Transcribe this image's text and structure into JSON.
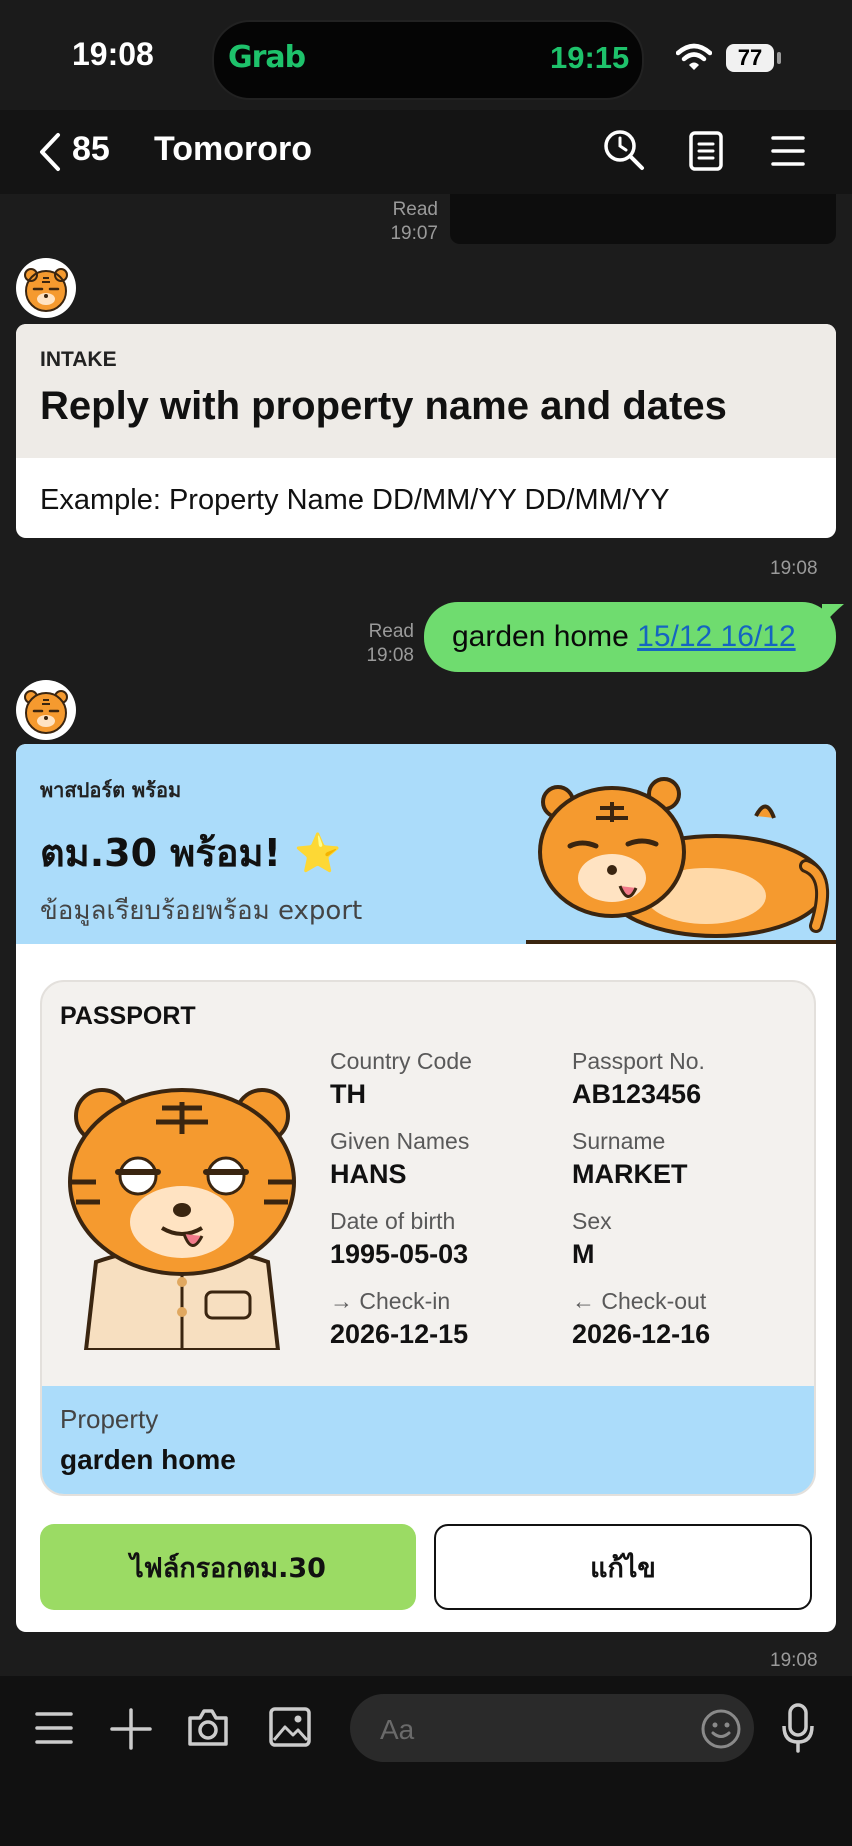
{
  "status_bar": {
    "time": "19:08",
    "island_app": "Grab",
    "island_time": "19:15",
    "battery": "77"
  },
  "nav": {
    "back_count": "85",
    "title": "Tomororo"
  },
  "messages": {
    "img_read": "Read",
    "img_time": "19:07",
    "intake": {
      "label": "INTAKE",
      "title": "Reply with property name and dates",
      "example": "Example: Property Name DD/MM/YY DD/MM/YY",
      "time": "19:08"
    },
    "user_msg": {
      "read": "Read",
      "time": "19:08",
      "text": "garden home",
      "dates": "15/12 16/12"
    },
    "passport_card": {
      "banner_small": "พาสปอร์ต พร้อม",
      "banner_title": "ตม.30 พร้อม!",
      "banner_star": "⭐",
      "banner_sub": "ข้อมูลเรียบร้อยพร้อม export",
      "passport_label": "PASSPORT",
      "fields": {
        "country_code_label": "Country Code",
        "country_code": "TH",
        "passport_no_label": "Passport No.",
        "passport_no": "AB123456",
        "given_names_label": "Given Names",
        "given_names": "HANS",
        "surname_label": "Surname",
        "surname": "MARKET",
        "dob_label": "Date of birth",
        "dob": "1995-05-03",
        "sex_label": "Sex",
        "sex": "M",
        "checkin_label": "→ Check-in",
        "checkin": "2026-12-15",
        "checkout_label": "← Check-out",
        "checkout": "2026-12-16"
      },
      "property_label": "Property",
      "property_value": "garden home",
      "primary_button": "ไฟล์กรอกตม.30",
      "secondary_button": "แก้ไข",
      "time": "19:08"
    }
  },
  "input": {
    "placeholder": "Aa"
  },
  "colors": {
    "accent_green": "#6fdc6f",
    "banner_blue": "#abdcfa",
    "button_green": "#9bdb64",
    "grab_green": "#1ec26b"
  }
}
